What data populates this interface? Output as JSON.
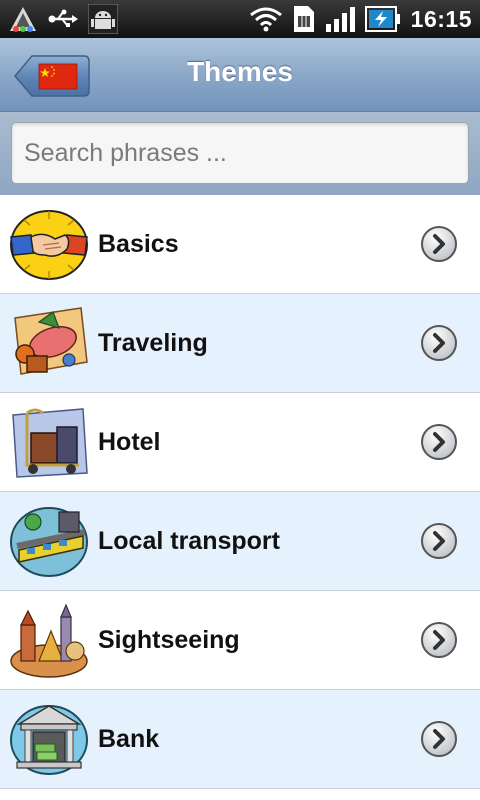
{
  "status_bar": {
    "time": "16:15",
    "icons": [
      "notification-triangle-icon",
      "usb-icon",
      "android-debug-icon",
      "wifi-icon",
      "sim-icon",
      "signal-icon",
      "battery-charging-icon"
    ]
  },
  "header": {
    "title": "Themes",
    "back_button_icon": "china-flag-icon"
  },
  "search": {
    "placeholder": "Search phrases ..."
  },
  "themes": {
    "items": [
      {
        "label": "Basics",
        "icon": "handshake-icon"
      },
      {
        "label": "Traveling",
        "icon": "travel-items-icon"
      },
      {
        "label": "Hotel",
        "icon": "luggage-cart-icon"
      },
      {
        "label": "Local transport",
        "icon": "train-icon"
      },
      {
        "label": "Sightseeing",
        "icon": "landmarks-icon"
      },
      {
        "label": "Bank",
        "icon": "bank-building-icon"
      }
    ]
  },
  "colors": {
    "header_gradient": [
      "#aec4db",
      "#7394ba"
    ],
    "row_alt": "#e5f1fc",
    "flag_red": "#de2910",
    "flag_yellow": "#ffde00"
  }
}
